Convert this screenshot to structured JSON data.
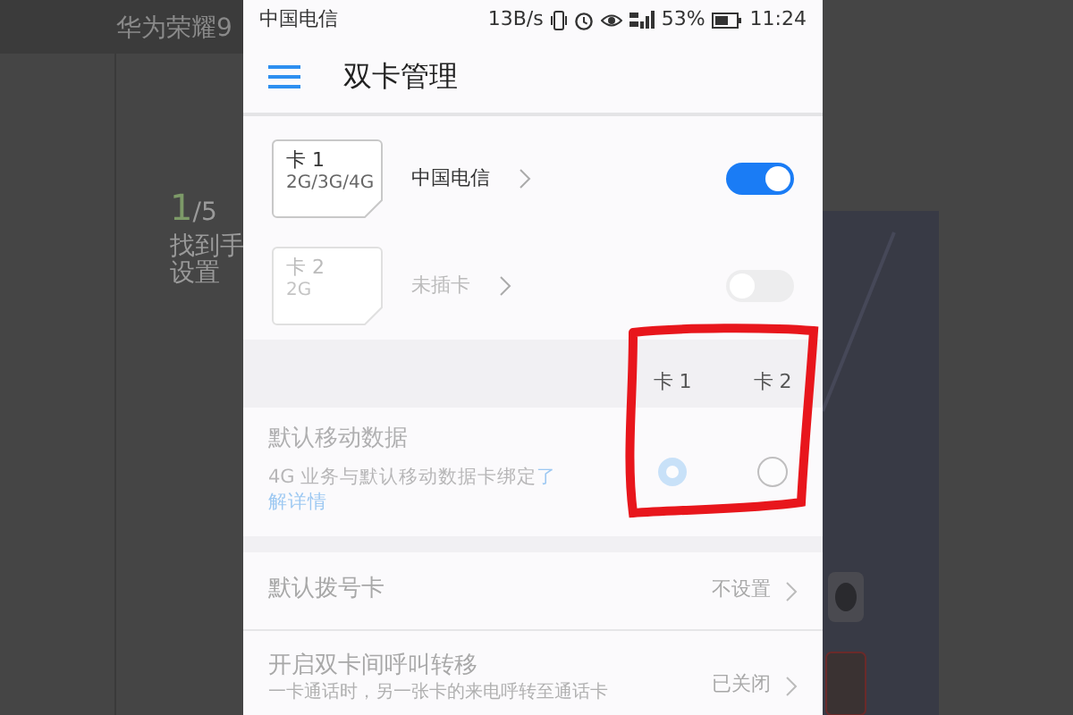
{
  "background_page": {
    "title": "华为荣耀9",
    "step_current": "1",
    "step_total": "/5",
    "step_text_lines": [
      "找到手",
      "设置"
    ]
  },
  "status_bar": {
    "carrier": "中国电信",
    "speed": "13B/s",
    "battery": "53%",
    "time": "11:24"
  },
  "header": {
    "title": "双卡管理"
  },
  "sims": [
    {
      "label": "卡 1",
      "bands": "2G/3G/4G",
      "carrier": "中国电信",
      "enabled": true
    },
    {
      "label": "卡 2",
      "bands": "2G",
      "carrier": "未插卡",
      "enabled": false
    }
  ],
  "data_section": {
    "columns": [
      "卡 1",
      "卡 2"
    ],
    "title": "默认移动数据",
    "description": "4G 业务与默认移动数据卡绑定",
    "link_lines": [
      "了",
      "解详情"
    ],
    "disabled": true,
    "options": [
      {
        "selected": true
      },
      {
        "selected": false
      }
    ]
  },
  "settings": [
    {
      "title": "默认拨号卡",
      "value": "不设置"
    },
    {
      "title": "开启双卡间呼叫转移",
      "description": "一卡通话时，另一张卡的来电呼转至通话卡",
      "value": "已关闭"
    }
  ]
}
